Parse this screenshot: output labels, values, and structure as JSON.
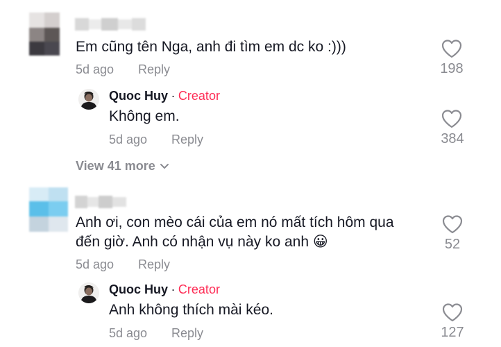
{
  "comments": [
    {
      "text": "Em cũng tên Nga, anh đi tìm em dc ko :)))",
      "time": "5d ago",
      "reply_label": "Reply",
      "likes": "198",
      "heart_icon": "heart-outline-icon",
      "reply": {
        "author": "Quoc Huy",
        "separator": "·",
        "badge": "Creator",
        "text": "Không em.",
        "time": "5d ago",
        "reply_label": "Reply",
        "likes": "384"
      },
      "view_more": "View 41 more"
    },
    {
      "text_lines": [
        "Anh ơi, con mèo cái của em nó mất tích hôm qua",
        "đến giờ. Anh có nhận vụ này ko anh 😀"
      ],
      "time": "5d ago",
      "reply_label": "Reply",
      "likes": "52",
      "reply": {
        "author": "Quoc Huy",
        "separator": "·",
        "badge": "Creator",
        "text": "Anh không thích mài kéo.",
        "time": "5d ago",
        "reply_label": "Reply",
        "likes": "127"
      }
    }
  ],
  "colors": {
    "text": "#161823",
    "muted": "#8a8b91",
    "creator": "#fe2c55"
  }
}
